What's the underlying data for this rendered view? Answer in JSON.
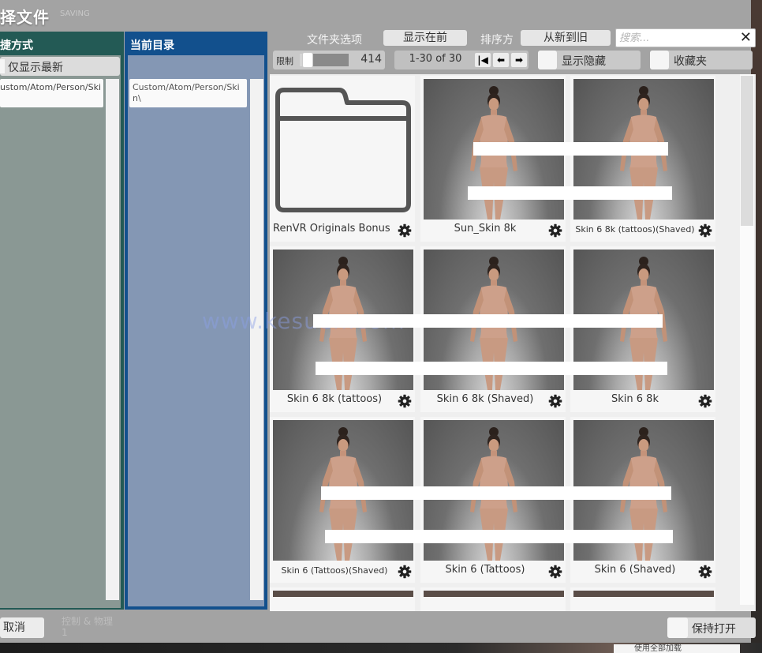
{
  "window": {
    "title": "择文件",
    "subtitle": "SAVING"
  },
  "shortcut_panel": {
    "title": "捷方式",
    "latest_only_label": "仅显示最新",
    "items": [
      {
        "label": "ustom/Atom/Person/Ski"
      }
    ]
  },
  "dir_panel": {
    "title": "当前目录",
    "current_path": "Custom/Atom/Person/Skin\\"
  },
  "toolbar": {
    "folder_options_label": "文件夹选项",
    "show_first_label": "显示在前",
    "sort_label": "排序方",
    "sort_value": "从新到旧",
    "search_placeholder": "搜索...",
    "search_value": "",
    "limit_label": "限制",
    "limit_value": "414",
    "limit_fraction": 0.12,
    "page_range": "1-30 of 30",
    "show_hidden_label": "显示隐藏",
    "favorites_label": "收藏夹"
  },
  "files": [
    {
      "name": "RenVR Originals Bonus",
      "kind": "folder"
    },
    {
      "name": "Sun_Skin 8k",
      "kind": "preview"
    },
    {
      "name": "Skin 6 8k (tattoos)(Shaved)",
      "kind": "preview"
    },
    {
      "name": "Skin 6 8k (tattoos)",
      "kind": "preview"
    },
    {
      "name": "Skin 6 8k (Shaved)",
      "kind": "preview"
    },
    {
      "name": "Skin 6 8k",
      "kind": "preview"
    },
    {
      "name": "Skin 6 (Tattoos)(Shaved)",
      "kind": "preview"
    },
    {
      "name": "Skin 6 (Tattoos)",
      "kind": "preview"
    },
    {
      "name": "Skin 6 (Shaved)",
      "kind": "preview"
    }
  ],
  "watermark": "www.kesuen.com",
  "footer": {
    "cancel_label": "取消",
    "faint_label": "控制 & 物理\n1",
    "keep_open_label": "保持打开",
    "bleed_label": "使用全部加载"
  },
  "colors": {
    "shortcut_panel": "#235a55",
    "dir_panel": "#12508d",
    "dialog_bg": "#a3a3a3"
  }
}
